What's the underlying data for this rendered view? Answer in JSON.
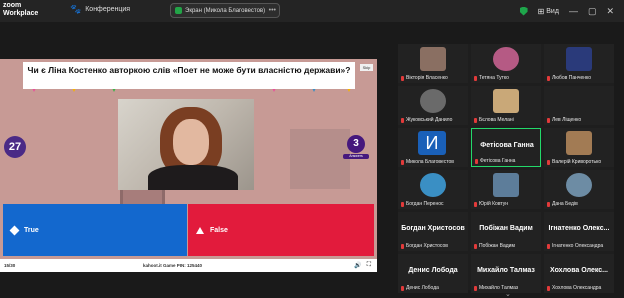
{
  "titlebar": {
    "logo_line1": "zoom",
    "logo_line2": "Workplace",
    "conference_label": "Конференция",
    "share_label": "Экран (Микола Благовестов)",
    "view_label": "Вид"
  },
  "stage": {
    "question": "Чи є Ліна Костенко авторкою слів «Поет не може бути власністю держави»?",
    "skip_label": "Skip",
    "timer": "27",
    "answers_count": "3",
    "answers_label": "Answers",
    "answer_true": "True",
    "answer_false": "False",
    "footer_count": "15/30",
    "footer_info": "kahoot.it  Game PIN: 125440"
  },
  "gallery": {
    "tiles": [
      {
        "name": "Вікторія Власенко",
        "avatar_color": "#8a6f62"
      },
      {
        "name": "Тетяна Тутко",
        "avatar_color": "#b55a84"
      },
      {
        "name": "Любов Панченко",
        "avatar_color": "#2a3a7a"
      },
      {
        "name": "Жуковський Данило",
        "avatar_color": "#6a6a6a"
      },
      {
        "name": "Бєлова Мелані",
        "avatar_color": "#c9a878"
      },
      {
        "name": "Лев Ліщенко",
        "avatar_color": "#222222"
      },
      {
        "name": "Микола Благовестов",
        "avatar_letter": "И",
        "avatar_color": "#1a60b8"
      },
      {
        "name": "Фетісова Ганна",
        "big_name": "Фетісова Ганна",
        "active": true
      },
      {
        "name": "Валерій Криворотько",
        "avatar_color": "#a27b54"
      },
      {
        "name": "Богдан Перенос",
        "avatar_color": "#3a8fc4"
      },
      {
        "name": "Юрій Ковтун",
        "avatar_color": "#5d7d9a"
      },
      {
        "name": "Дана Бедів",
        "avatar_color": "#6d8ca4"
      },
      {
        "name": "Богдан Христосов",
        "big_name": "Богдан Христосов"
      },
      {
        "name": "Побіжан Вадим",
        "big_name": "Побіжан Вадим"
      },
      {
        "name": "Ігнатенко Олександра",
        "big_name": "Ігнатенко Олекс..."
      },
      {
        "name": "Денис Лобода",
        "big_name": "Денис Лобода"
      },
      {
        "name": "Михайло Талмаз",
        "big_name": "Михайло Талмаз"
      },
      {
        "name": "Хохлова Олександра",
        "big_name": "Хохлова Олекс..."
      }
    ],
    "more_label": "⌄"
  }
}
